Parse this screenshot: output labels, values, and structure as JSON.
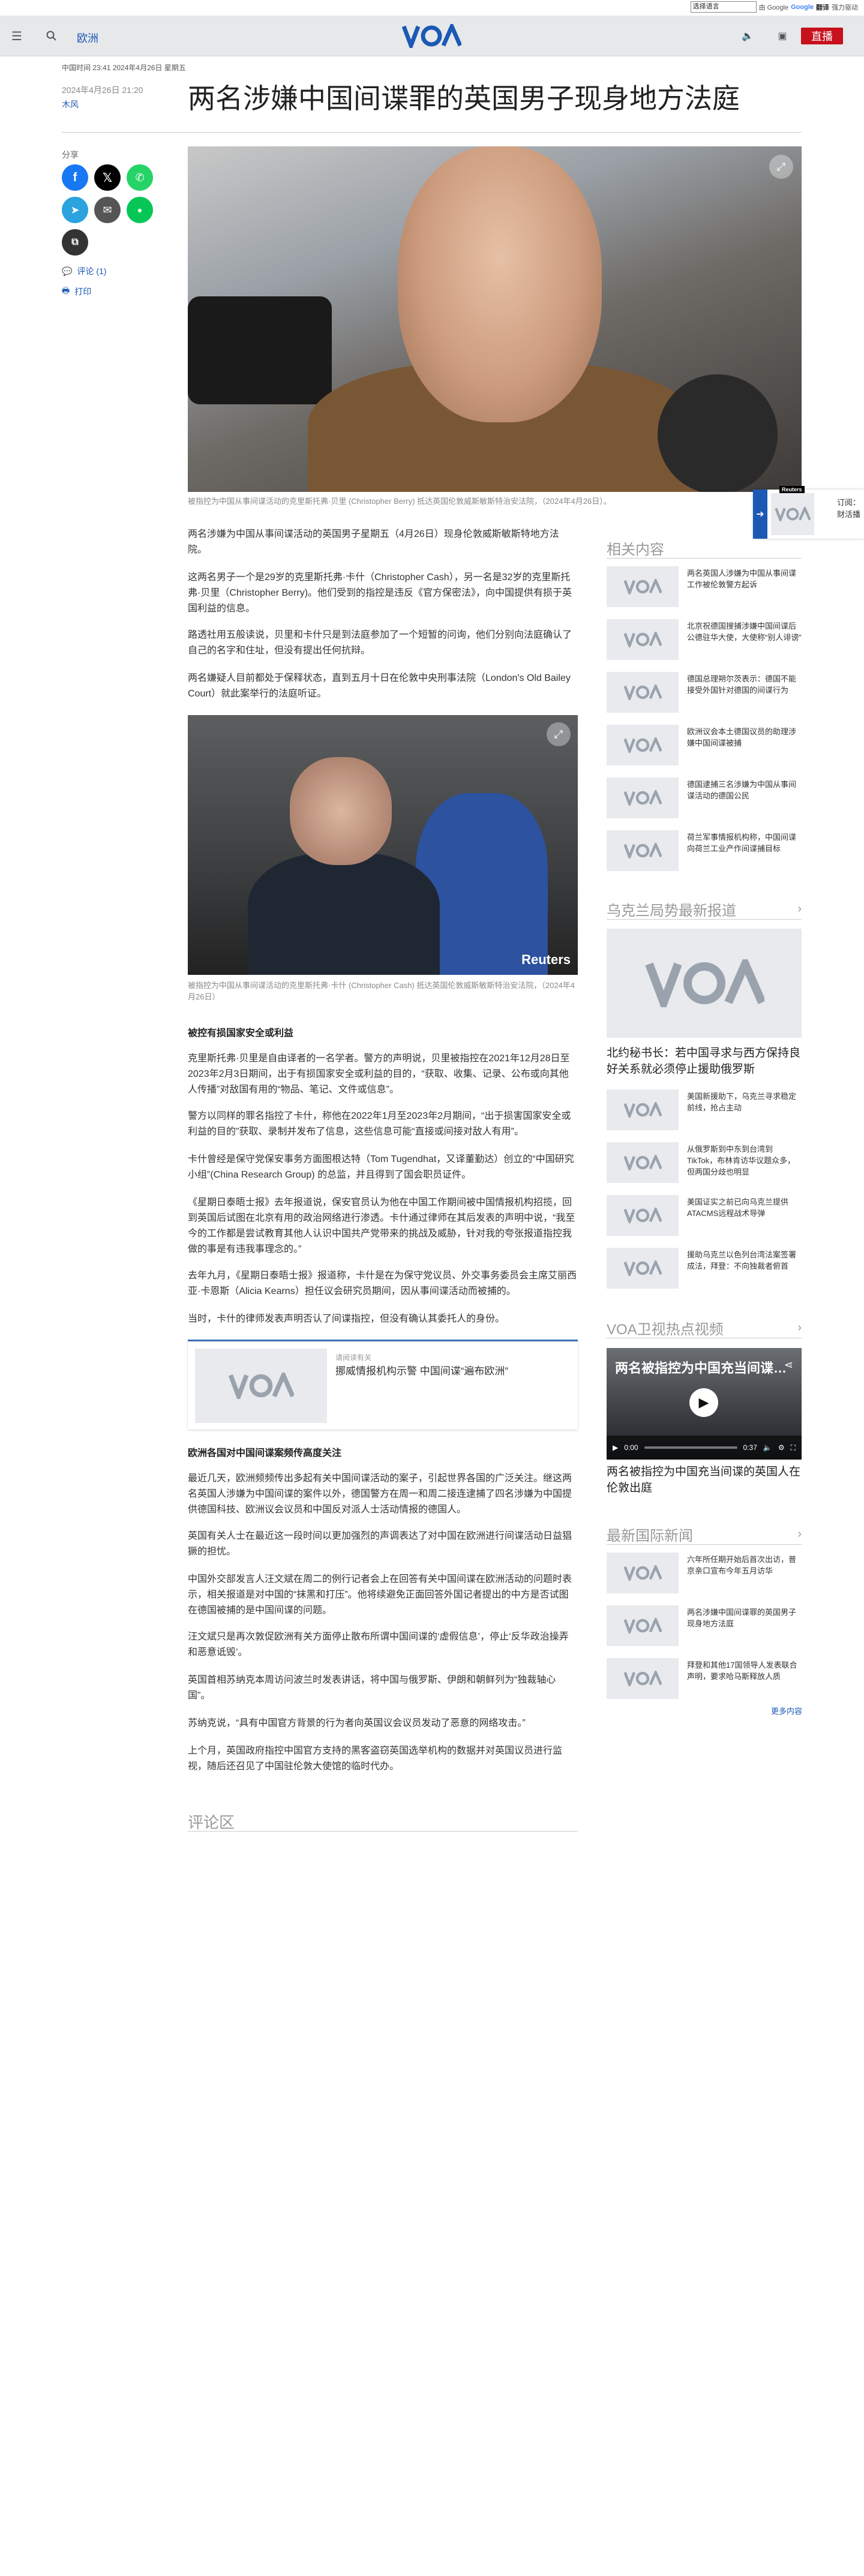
{
  "translate": {
    "select_label": "选择语言",
    "powered": "由 Google",
    "product": "翻译",
    "suffix": "强力驱动"
  },
  "header": {
    "section": "欧洲",
    "live_label": "直播"
  },
  "article": {
    "meta_top": "中国时间 23:41 2024年4月26日 星期五",
    "date": "2024年4月26日 21:20",
    "author": "木风",
    "title": "两名涉嫌中国间谍罪的英国男子现身地方法庭",
    "hero_caption": "被指控为中国从事间谍活动的克里斯托弗·贝里 (Christopher Berry) 抵达英国伦敦威斯敏斯特治安法院，（2024年4月26日）。",
    "paras1": [
      "两名涉嫌为中国从事间谍活动的英国男子星期五（4月26日）现身伦敦威斯敏斯特地方法院。",
      "这两名男子一个是29岁的克里斯托弗·卡什（Christopher Cash），另一名是32岁的克里斯托弗·贝里（Christopher Berry)。他们受到的指控是违反《官方保密法》，向中国提供有损于英国利益的信息。",
      "路透社用五般读说，贝里和卡什只是到法庭参加了一个短暂的问询，他们分别向法庭确认了自己的名字和住址，但没有提出任何抗辩。",
      "两名嫌疑人目前都处于保释状态，直到五月十日在伦敦中央刑事法院（London's Old Bailey Court）就此案举行的法庭听证。"
    ],
    "photo2_caption": "被指控为中国从事间谍活动的克里斯托弗·卡什 (Christopher Cash) 抵达英国伦敦威斯敏斯特治安法院，（2024年4月26日）",
    "reuters": "Reuters",
    "heading1": "被控有损国家安全或利益",
    "paras2": [
      "克里斯托弗·贝里是自由译者的一名学者。警方的声明说，贝里被指控在2021年12月28日至2023年2月3日期间，出于有损国家安全或利益的目的，“获取、收集、记录、公布或向其他人传播”对敌国有用的“物品、笔记、文件或信息”。",
      "警方以同样的罪名指控了卡什，称他在2022年1月至2023年2月期间，“出于损害国家安全或利益的目的”获取、录制并发布了信息，这些信息可能“直接或间接对敌人有用”。",
      "卡什曾经是保守党保安事务方面图根达特（Tom Tugendhat，又译董勤达）创立的“中国研究小组”(China Research Group) 的总监，并且得到了国会职员证件。",
      "《星期日泰晤士报》去年报道说，保安官员认为他在中国工作期间被中国情报机构招揽，回到英国后试图在北京有用的政治网络进行渗透。卡什通过律师在其后发表的声明中说，“我至今的工作都是尝试教育其他人认识中国共产党带来的挑战及威胁，针对我的夸张报道指控我做的事是有违我事理念的。”",
      "去年九月，《星期日泰晤士报》报道称，卡什是在为保守党议员、外交事务委员会主席艾丽西亚·卡恩斯（Alicia Kearns）担任议会研究员期间，因从事间谍活动而被捕的。",
      "当时，卡什的律师发表声明否认了间谍指控，但没有确认其委托人的身份。"
    ],
    "related_card": {
      "label": "请阅读有关",
      "title": "挪威情报机构示警 中国间谍“遍布欧洲”"
    },
    "heading2": "欧洲各国对中国间谍案频传高度关注",
    "paras3": [
      "最近几天，欧洲频频传出多起有关中国间谍活动的案子，引起世界各国的广泛关注。继这两名英国人涉嫌为中国间谍的案件以外，德国警方在周一和周二接连逮捕了四名涉嫌为中国提供德国科技、欧洲议会议员和中国反对派人士活动情报的德国人。",
      "英国有关人士在最近这一段时间以更加强烈的声调表达了对中国在欧洲进行间谍活动日益猖獗的担忧。",
      "中国外交部发言人汪文斌在周二的例行记者会上在回答有关中国间谍在欧洲活动的问题时表示，相关报道是对中国的“抹黑和打压”。他将续避免正面回答外国记者提出的中方是否试图在德国被捕的是中国间谍的问题。",
      "汪文斌只是再次敦促欧洲有关方面停止散布所谓中国间谍的‘虚假信息’，停止‘反华政治操弄和恶意诋毁’。",
      "英国首相苏纳克本周访问波兰时发表讲话，将中国与俄罗斯、伊朗和朝鲜列为“独裁轴心国”。",
      "苏纳克说，“具有中国官方背景的行为者向英国议会议员发动了恶意的网络攻击。”",
      "上个月，英国政府指控中国官方支持的黑客盗窃英国选举机构的数据并对英国议员进行监视，随后还召见了中国驻伦敦大使馆的临时代办。"
    ],
    "comments_label": "评论区"
  },
  "share": {
    "label": "分享",
    "comments_link": "评论 (1)",
    "print_link": "打印"
  },
  "sidebar": {
    "related_heading": "相关内容",
    "related_items": [
      "两名英国人涉嫌为中国从事间谍工作被伦敦警方起诉",
      "北京祝德国搜捕涉嫌中国间谍后公德驻华大使，大使称“别人诽谤”",
      "德国总理朔尔茨表示：德国不能接受外国针对德国的间谍行为",
      "欧洲议会本土德国议员的助理涉嫌中国间谍被捕",
      "德国逮捕三名涉嫌为中国从事间谍活动的德国公民",
      "荷兰军事情报机构称，中国间谍向荷兰工业产作间谍捕目标"
    ],
    "ukraine_heading": "乌克兰局势最新报道",
    "ukraine_lead": "北约秘书长：若中国寻求与西方保持良好关系就必须停止援助俄罗斯",
    "ukraine_items": [
      "美国新援助下，乌克兰寻求稳定前线，抢占主动",
      "从俄罗斯到中东到台湾到TikTok，布林肯访华议题众多，但两国分歧也明显",
      "美国证实之前已向乌克兰提供ATACMS远程战术导弹",
      "援助乌克兰以色列台湾法案签署成法，拜登：不向独裁者俯首"
    ],
    "video_heading": "VOA卫视热点视频",
    "video_overlay": "两名被指控为中国充当间谍…",
    "video_time_cur": "0:00",
    "video_time_total": "0:37",
    "video_title": "两名被指控为中国充当间谍的英国人在伦敦出庭",
    "world_heading": "最新国际新闻",
    "world_items": [
      "六年所任期开始后首次出访，普京亲口宣布今年五月访华",
      "两名涉嫌中国间谍罪的英国男子现身地方法庭",
      "拜登和其他17国领导人发表联合声明，要求哈马斯释放人质"
    ],
    "more": "更多内容"
  },
  "float_card": {
    "badge": "Reuters",
    "text_lines": [
      "订阅：",
      "财活播"
    ]
  },
  "colors": {
    "brand_blue": "#1c59b5",
    "live_red": "#c7111c",
    "header_bg": "#e6e8ea"
  }
}
